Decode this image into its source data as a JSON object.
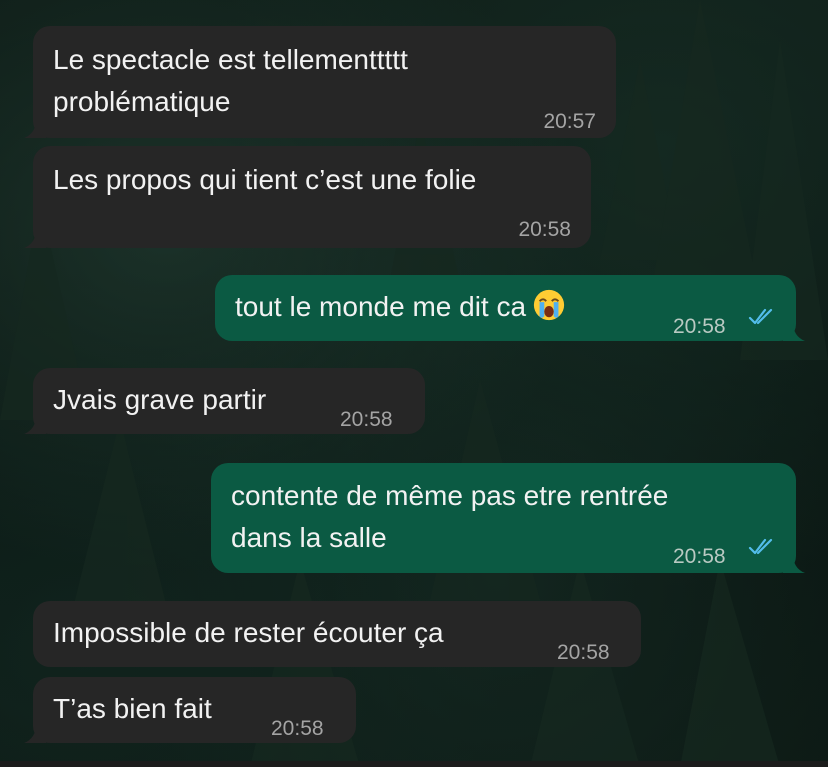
{
  "messages": [
    {
      "lines": [
        "Le spectacle est tellementtttt",
        "problématique"
      ],
      "time": "20:57",
      "direction": "incoming"
    },
    {
      "lines": [
        "Les propos qui tient c’est une folie"
      ],
      "time": "20:58",
      "direction": "incoming"
    },
    {
      "lines": [
        "tout le monde me dit ca"
      ],
      "emoji": "loudly-crying-face-icon",
      "time": "20:58",
      "direction": "outgoing",
      "status": "read"
    },
    {
      "lines": [
        "Jvais grave partir"
      ],
      "time": "20:58",
      "direction": "incoming"
    },
    {
      "lines": [
        "contente de même pas etre rentrée",
        "dans la salle"
      ],
      "time": "20:58",
      "direction": "outgoing",
      "status": "read"
    },
    {
      "lines": [
        "Impossible de rester écouter ça"
      ],
      "time": "20:58",
      "direction": "incoming"
    },
    {
      "lines": [
        "T’as bien fait"
      ],
      "time": "20:58",
      "direction": "incoming"
    }
  ],
  "colors": {
    "incoming_bubble": "#262626",
    "outgoing_bubble": "#0b5a43",
    "read_ticks": "#53bdeb",
    "text": "#f2f2f2"
  }
}
